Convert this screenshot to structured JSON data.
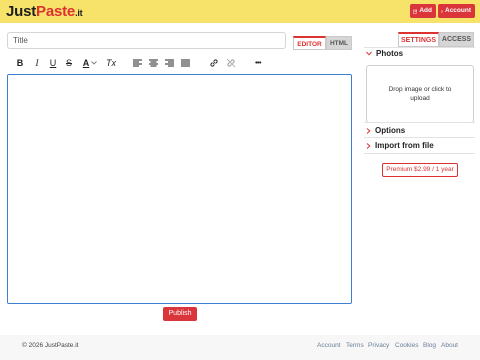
{
  "header": {
    "logo": {
      "just": "Just",
      "paste": "Paste",
      "it": ".it"
    },
    "add_label": "Add",
    "account_label": "Account"
  },
  "title_input": {
    "placeholder": "Title",
    "value": ""
  },
  "editor_tabs": {
    "editor": "EDITOR",
    "html": "HTML",
    "active": "EDITOR"
  },
  "toolbar": {
    "bold": "B",
    "italic": "I",
    "underline": "U",
    "strikethrough": "S",
    "text_color": "A",
    "clear_format": "Tx",
    "more": "•••"
  },
  "publish_label": "Publish",
  "sidebar": {
    "tabs": {
      "settings": "SETTINGS",
      "access": "ACCESS",
      "active": "SETTINGS"
    },
    "photos_label": "Photos",
    "dropzone_text": "Drop image or click to upload",
    "options_label": "Options",
    "import_label": "Import from file",
    "premium_label": "Premium $2.99 / 1 year"
  },
  "footer": {
    "copyright": "© 2026 JustPaste.it",
    "links": [
      "Account",
      "Terms",
      "Privacy",
      "Cookies",
      "Blog",
      "About"
    ]
  },
  "colors": {
    "header_bg": "#f8e36a",
    "brand_red": "#dc3232",
    "editor_focus_border": "#3a7fd0"
  }
}
